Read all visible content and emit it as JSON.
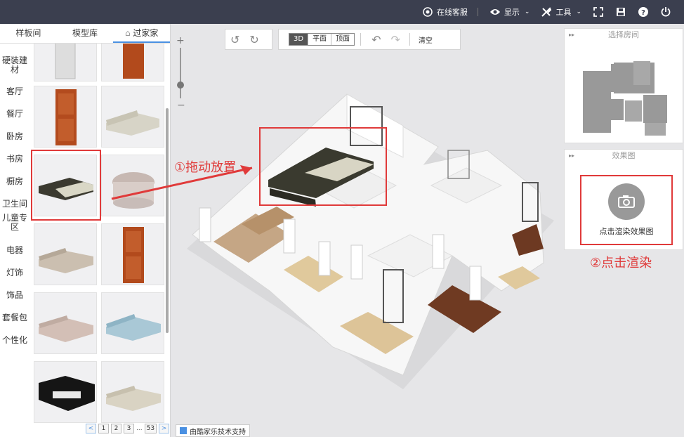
{
  "topbar": {
    "service": "在线客服",
    "display": "显示",
    "tools": "工具"
  },
  "left": {
    "tabs": [
      "样板间",
      "模型库",
      "过家家"
    ],
    "categories": [
      "硬装建材",
      "客厅",
      "餐厅",
      "卧房",
      "书房",
      "橱房",
      "卫生间",
      "儿童专区",
      "电器",
      "灯饰",
      "饰品",
      "套餐包",
      "个性化"
    ],
    "pager": {
      "pages": [
        "1",
        "2",
        "3"
      ],
      "ellipsis": "...",
      "last": "53",
      "prev": "<",
      "next": ">"
    }
  },
  "toolbar": {
    "view_modes": [
      "3D",
      "平面",
      "顶面"
    ],
    "active_mode": "3D",
    "clear": "清空"
  },
  "annotations": {
    "drag_hint": "①拖动放置",
    "render_hint": "②点击渲染"
  },
  "right": {
    "select_room_title": "选择房间",
    "render_title": "效果图",
    "render_button": "点击渲染效果图"
  },
  "footer": {
    "brand": "由酷家乐技术支持"
  },
  "colors": {
    "topbar": "#3b3f4f",
    "accent": "#4a90e2",
    "annotation": "#e03a3a"
  }
}
